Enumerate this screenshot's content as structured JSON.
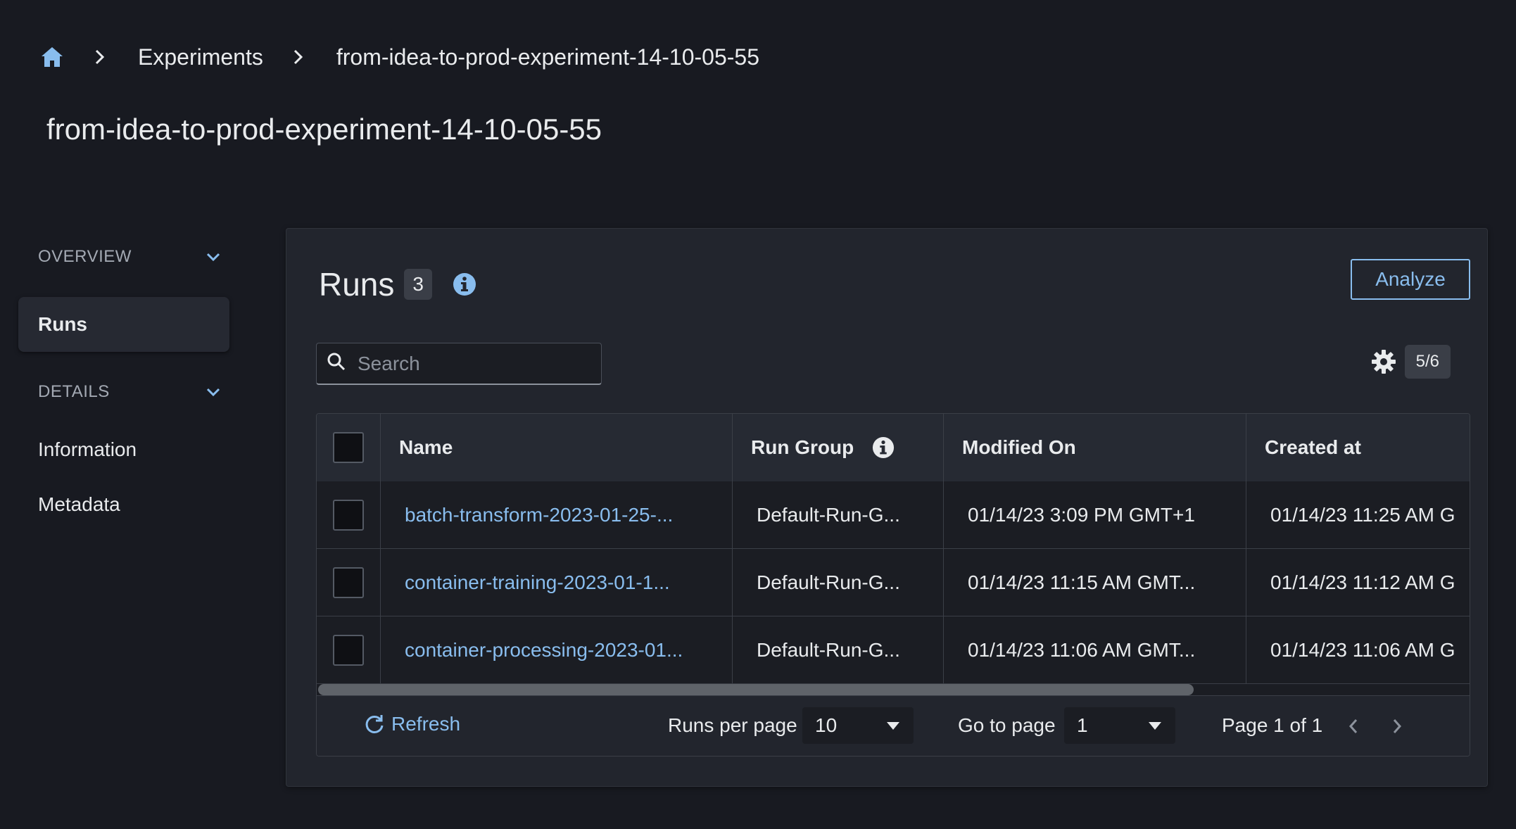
{
  "breadcrumb": {
    "home_icon": "home-icon",
    "items": [
      "Experiments",
      "from-idea-to-prod-experiment-14-10-05-55"
    ]
  },
  "page_title": "from-idea-to-prod-experiment-14-10-05-55",
  "sidenav": {
    "overview_label": "OVERVIEW",
    "runs_label": "Runs",
    "details_label": "DETAILS",
    "information_label": "Information",
    "metadata_label": "Metadata"
  },
  "runs": {
    "title": "Runs",
    "count": "3",
    "analyze_label": "Analyze",
    "search_placeholder": "Search",
    "columns_badge": "5/6"
  },
  "table": {
    "headers": [
      "Name",
      "Run Group",
      "Modified On",
      "Created at"
    ],
    "rows": [
      {
        "name": "batch-transform-2023-01-25-...",
        "run_group": "Default-Run-G...",
        "modified_on": "01/14/23 3:09 PM GMT+1",
        "created_at": "01/14/23 11:25 AM G"
      },
      {
        "name": "container-training-2023-01-1...",
        "run_group": "Default-Run-G...",
        "modified_on": "01/14/23 11:15 AM GMT...",
        "created_at": "01/14/23 11:12 AM G"
      },
      {
        "name": "container-processing-2023-01...",
        "run_group": "Default-Run-G...",
        "modified_on": "01/14/23 11:06 AM GMT...",
        "created_at": "01/14/23 11:06 AM G"
      }
    ]
  },
  "footer": {
    "refresh_label": "Refresh",
    "runs_per_page_label": "Runs per page",
    "runs_per_page_value": "10",
    "go_to_page_label": "Go to page",
    "go_to_page_value": "1",
    "page_status": "Page 1 of 1"
  },
  "colors": {
    "background": "#181a21",
    "panel": "#22252d",
    "link": "#89bdee",
    "text": "#e9ebed"
  }
}
